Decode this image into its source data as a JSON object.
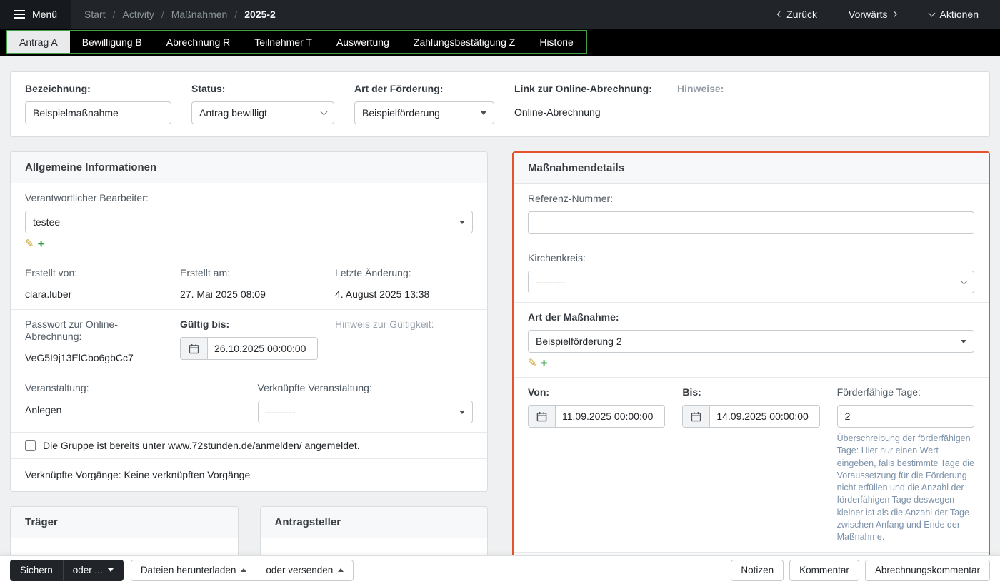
{
  "icons": {
    "back_chevron": "‹",
    "forward_chevron": "›",
    "pencil": "✎",
    "plus": "+"
  },
  "topbar": {
    "menu_label": "Menü",
    "separator": "/",
    "breadcrumb": [
      "Start",
      "Activity",
      "Maßnahmen",
      "2025-2"
    ],
    "back_label": "Zurück",
    "forward_label": "Vorwärts",
    "actions_label": "Aktionen"
  },
  "tabs": {
    "items": [
      {
        "label": "Antrag A",
        "active": true
      },
      {
        "label": "Bewilligung B",
        "active": false
      },
      {
        "label": "Abrechnung R",
        "active": false
      },
      {
        "label": "Teilnehmer T",
        "active": false
      },
      {
        "label": "Auswertung",
        "active": false
      },
      {
        "label": "Zahlungsbestätigung Z",
        "active": false
      },
      {
        "label": "Historie",
        "active": false
      }
    ]
  },
  "header_card": {
    "bezeichnung_label": "Bezeichnung:",
    "bezeichnung_value": "Beispielmaßnahme",
    "status_label": "Status:",
    "status_value": "Antrag bewilligt",
    "foerderung_label": "Art der Förderung:",
    "foerderung_value": "Beispielförderung",
    "link_label": "Link zur Online-Abrechnung:",
    "link_value": "Online-Abrechnung",
    "hinweise_label": "Hinweise:"
  },
  "allgemein": {
    "title": "Allgemeine Informationen",
    "bearbeiter_label": "Verantwortlicher Bearbeiter:",
    "bearbeiter_value": "testee",
    "erstellt_von_label": "Erstellt von:",
    "erstellt_von_value": "clara.luber",
    "erstellt_am_label": "Erstellt am:",
    "erstellt_am_value": "27. Mai 2025 08:09",
    "letzte_aenderung_label": "Letzte Änderung:",
    "letzte_aenderung_value": "4. August 2025 13:38",
    "passwort_label": "Passwort zur Online-Abrechnung:",
    "passwort_value": "VeG5I9j13ElCbo6gbCc7",
    "gueltig_label": "Gültig bis:",
    "gueltig_value": "26.10.2025 00:00:00",
    "hinweis_gueltigkeit_label": "Hinweis zur Gültigkeit:",
    "veranstaltung_label": "Veranstaltung:",
    "veranstaltung_link": "Anlegen",
    "verknuepfte_label": "Verknüpfte Veranstaltung:",
    "verknuepfte_value": "---------",
    "checkbox_label": "Die Gruppe ist bereits unter www.72stunden.de/anmelden/ angemeldet.",
    "vorgaenge_text": "Verknüpfte Vorgänge: Keine verknüpften Vorgänge"
  },
  "traeger": {
    "title": "Träger"
  },
  "antragsteller": {
    "title": "Antragsteller"
  },
  "details": {
    "title": "Maßnahmendetails",
    "referenz_label": "Referenz-Nummer:",
    "referenz_value": "",
    "kirchenkreis_label": "Kirchenkreis:",
    "kirchenkreis_value": "---------",
    "art_label": "Art der Maßnahme:",
    "art_value": "Beispielförderung 2",
    "von_label": "Von:",
    "von_value": "11.09.2025 00:00:00",
    "bis_label": "Bis:",
    "bis_value": "14.09.2025 00:00:00",
    "tage_label": "Förderfähige Tage:",
    "tage_value": "2",
    "tage_help": "Überschreibung der förderfähigen Tage: Hier nur einen Wert eingeben, falls bestimmte Tage die Voraussetzung für die Förderung nicht erfüllen und die Anzahl der förderfähigen Tage deswegen kleiner ist als die Anzahl der Tage zwischen Anfang und Ende der Maßnahme."
  },
  "footer": {
    "sichern": "Sichern",
    "oder": "oder ...",
    "dateien": "Dateien herunterladen",
    "versenden": "oder versenden",
    "notizen": "Notizen",
    "kommentar": "Kommentar",
    "abrechnungskommentar": "Abrechnungskommentar"
  },
  "colors": {
    "accent_green": "#43a047",
    "highlight_red": "#e4532c",
    "topbar_bg": "#212529"
  }
}
